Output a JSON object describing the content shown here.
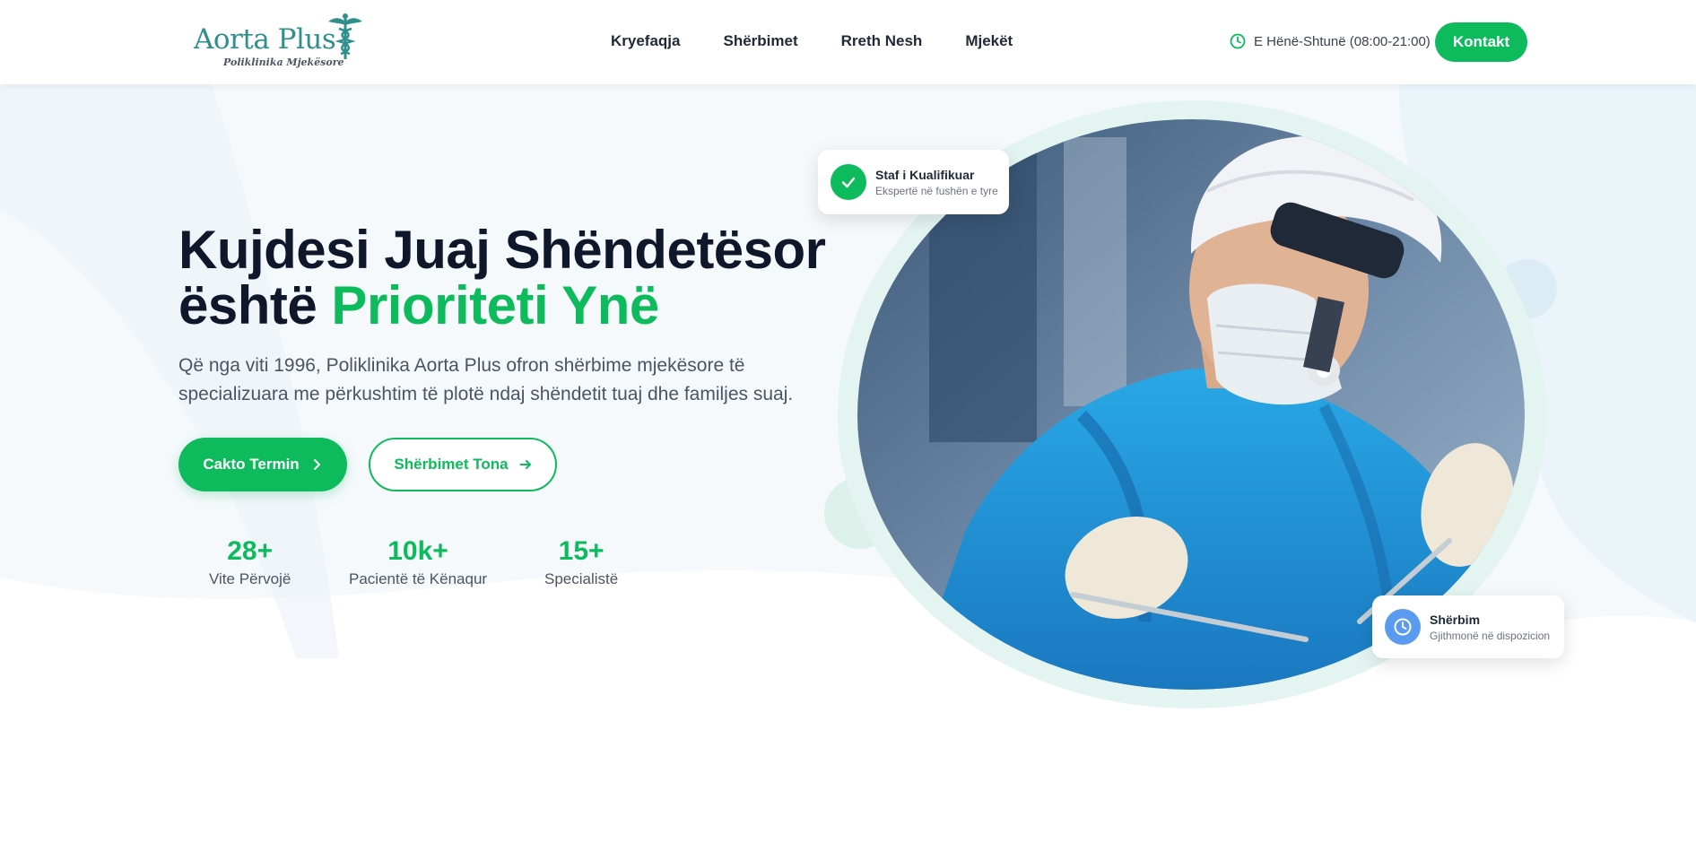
{
  "brand": {
    "name": "Aorta Plus",
    "tagline": "Poliklinika Mjekësore",
    "primary_color": "#0dbb5d",
    "logo_color": "#2f8f8b"
  },
  "nav": {
    "items": [
      {
        "label": "Kryefaqja"
      },
      {
        "label": "Shërbimet"
      },
      {
        "label": "Rreth Nesh"
      },
      {
        "label": "Mjekët"
      }
    ]
  },
  "header": {
    "hours_icon": "clock-icon",
    "hours": "E Hënë-Shtunë (08:00-21:00)",
    "contact_label": "Kontakt"
  },
  "hero": {
    "title_line1": "Kujdesi Juaj Shëndetësor",
    "title_line2_prefix": "është",
    "title_line2_accent": "Prioriteti Ynë",
    "description": "Që nga viti 1996, Poliklinika Aorta Plus ofron shërbime mjekësore të specializuara me përkushtim të plotë ndaj shëndetit tuaj dhe familjes suaj.",
    "primary_button": "Cakto Termin",
    "primary_button_icon": "chevron-right-icon",
    "secondary_button": "Shërbimet Tona",
    "secondary_button_icon": "arrow-right-icon"
  },
  "stats": [
    {
      "value": "28+",
      "label": "Vite Përvojë"
    },
    {
      "value": "10k+",
      "label": "Pacientë të Kënaqur"
    },
    {
      "value": "15+",
      "label": "Specialistë"
    }
  ],
  "cards": {
    "staff": {
      "icon": "check-icon",
      "title": "Staf i Kualifikuar",
      "subtitle": "Ekspertë në fushën e tyre"
    },
    "service": {
      "icon": "clock-icon",
      "title": "Shërbim",
      "subtitle": "Gjithmonë në dispozicion"
    }
  }
}
